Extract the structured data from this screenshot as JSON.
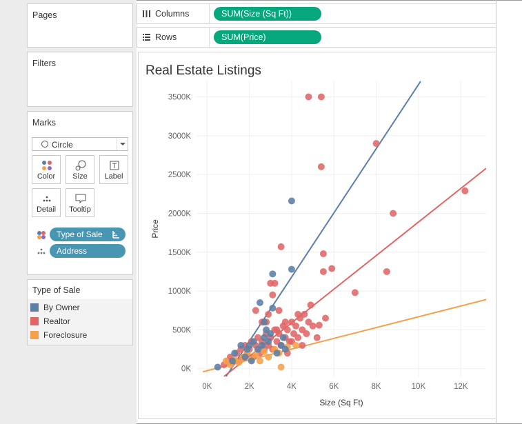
{
  "shelves": {
    "pages_title": "Pages",
    "columns_label": "Columns",
    "columns_field": "SUM(Size (Sq Ft))",
    "rows_label": "Rows",
    "rows_field": "SUM(Price)"
  },
  "filters": {
    "title": "Filters"
  },
  "marks": {
    "title": "Marks",
    "mark_type": "Circle",
    "buttons": {
      "color": "Color",
      "size": "Size",
      "label": "Label",
      "detail": "Detail",
      "tooltip": "Tooltip"
    },
    "fields": [
      {
        "name": "Type of Sale",
        "encoding": "color-icon"
      },
      {
        "name": "Address",
        "encoding": "detail-icon"
      }
    ]
  },
  "legend": {
    "title": "Type of Sale",
    "items": [
      {
        "label": "By Owner",
        "color": "#5b7fa6"
      },
      {
        "label": "Realtor",
        "color": "#e06666"
      },
      {
        "label": "Foreclosure",
        "color": "#f5a04a"
      }
    ]
  },
  "chart_data": {
    "type": "scatter",
    "title": "Real Estate Listings",
    "xlabel": "Size (Sq Ft)",
    "ylabel": "Price",
    "xlim": [
      -500,
      13200
    ],
    "ylim": [
      -100000,
      3700000
    ],
    "x_ticks": [
      0,
      2000,
      4000,
      6000,
      8000,
      10000,
      12000
    ],
    "x_tick_labels": [
      "0K",
      "2K",
      "4K",
      "6K",
      "8K",
      "10K",
      "12K"
    ],
    "y_ticks": [
      0,
      500000,
      1000000,
      1500000,
      2000000,
      2500000,
      3000000,
      3500000
    ],
    "y_tick_labels": [
      "0K",
      "500K",
      "1000K",
      "1500K",
      "2000K",
      "2500K",
      "3000K",
      "3500K"
    ],
    "grid": true,
    "series": [
      {
        "name": "By Owner",
        "color": "#5b7fa6",
        "points": [
          [
            500,
            20000
          ],
          [
            1200,
            100000
          ],
          [
            1300,
            200000
          ],
          [
            1800,
            150000
          ],
          [
            1900,
            250000
          ],
          [
            2000,
            300000
          ],
          [
            2100,
            100000
          ],
          [
            2200,
            350000
          ],
          [
            2400,
            250000
          ],
          [
            2600,
            300000
          ],
          [
            2700,
            400000
          ],
          [
            2900,
            350000
          ],
          [
            3000,
            450000
          ],
          [
            2800,
            500000
          ],
          [
            3100,
            780000
          ],
          [
            3300,
            200000
          ],
          [
            3500,
            300000
          ],
          [
            3700,
            250000
          ],
          [
            4000,
            1280000
          ],
          [
            4000,
            2160000
          ],
          [
            3100,
            1220000
          ],
          [
            2500,
            850000
          ],
          [
            2700,
            600000
          ],
          [
            1600,
            300000
          ],
          [
            3600,
            400000
          ]
        ],
        "trend": [
          [
            900,
            -100000
          ],
          [
            10100,
            3700000
          ]
        ]
      },
      {
        "name": "Realtor",
        "color": "#e06666",
        "points": [
          [
            800,
            50000
          ],
          [
            1000,
            100000
          ],
          [
            1100,
            150000
          ],
          [
            1200,
            80000
          ],
          [
            1400,
            200000
          ],
          [
            1500,
            100000
          ],
          [
            1600,
            250000
          ],
          [
            1700,
            150000
          ],
          [
            1800,
            300000
          ],
          [
            1900,
            200000
          ],
          [
            2000,
            250000
          ],
          [
            2100,
            350000
          ],
          [
            2200,
            150000
          ],
          [
            2300,
            300000
          ],
          [
            2400,
            400000
          ],
          [
            2500,
            200000
          ],
          [
            2600,
            350000
          ],
          [
            2700,
            250000
          ],
          [
            2800,
            450000
          ],
          [
            2900,
            300000
          ],
          [
            3000,
            400000
          ],
          [
            3100,
            250000
          ],
          [
            3200,
            500000
          ],
          [
            3300,
            350000
          ],
          [
            3400,
            450000
          ],
          [
            3500,
            300000
          ],
          [
            3600,
            550000
          ],
          [
            3700,
            400000
          ],
          [
            3800,
            500000
          ],
          [
            3900,
            350000
          ],
          [
            4000,
            600000
          ],
          [
            4100,
            450000
          ],
          [
            4200,
            550000
          ],
          [
            4300,
            400000
          ],
          [
            4400,
            650000
          ],
          [
            4500,
            500000
          ],
          [
            4600,
            700000
          ],
          [
            4700,
            450000
          ],
          [
            4800,
            600000
          ],
          [
            5000,
            550000
          ],
          [
            5200,
            400000
          ],
          [
            3400,
            750000
          ],
          [
            2800,
            600000
          ],
          [
            3100,
            950000
          ],
          [
            3000,
            1100000
          ],
          [
            3200,
            1100000
          ],
          [
            3500,
            1570000
          ],
          [
            4800,
            3500000
          ],
          [
            5400,
            3500000
          ],
          [
            5400,
            2600000
          ],
          [
            5500,
            1480000
          ],
          [
            5500,
            1250000
          ],
          [
            5900,
            1290000
          ],
          [
            7000,
            980000
          ],
          [
            8000,
            2900000
          ],
          [
            8500,
            1250000
          ],
          [
            8800,
            2000000
          ],
          [
            12200,
            2290000
          ],
          [
            5300,
            560000
          ],
          [
            5600,
            650000
          ],
          [
            4300,
            700000
          ],
          [
            4900,
            820000
          ],
          [
            2900,
            700000
          ],
          [
            2300,
            750000
          ],
          [
            3800,
            200000
          ],
          [
            4000,
            350000
          ],
          [
            4500,
            300000
          ],
          [
            2600,
            600000
          ],
          [
            3300,
            500000
          ],
          [
            3700,
            600000
          ]
        ],
        "trend": [
          [
            800,
            -100000
          ],
          [
            13200,
            2580000
          ]
        ]
      },
      {
        "name": "Foreclosure",
        "color": "#f5a04a",
        "points": [
          [
            900,
            100000
          ],
          [
            1100,
            50000
          ],
          [
            1300,
            120000
          ],
          [
            1500,
            80000
          ],
          [
            1700,
            150000
          ],
          [
            1900,
            200000
          ],
          [
            2100,
            120000
          ],
          [
            2300,
            180000
          ],
          [
            2500,
            100000
          ],
          [
            2700,
            220000
          ],
          [
            2900,
            150000
          ],
          [
            3200,
            250000
          ],
          [
            3400,
            200000
          ],
          [
            3500,
            20000
          ],
          [
            3800,
            280000
          ],
          [
            4200,
            300000
          ]
        ],
        "trend": [
          [
            -200,
            -40000
          ],
          [
            13200,
            890000
          ]
        ]
      }
    ]
  }
}
